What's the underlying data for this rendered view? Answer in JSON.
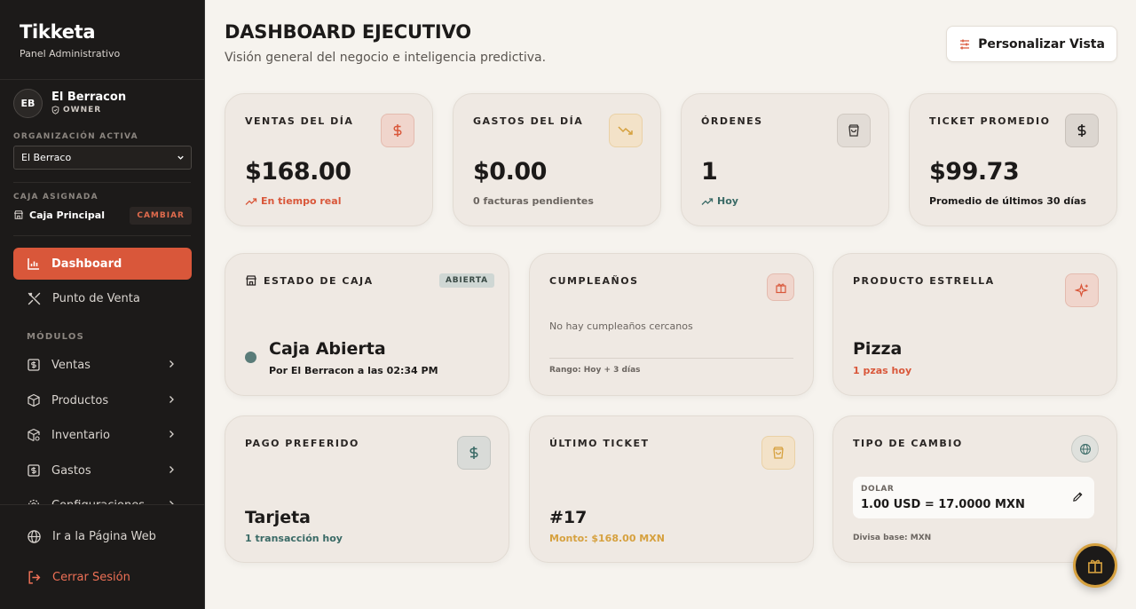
{
  "sidebar": {
    "brand_title": "Tikketa",
    "brand_sub": "Panel Administrativo",
    "user": {
      "initials": "EB",
      "name": "El Berracon",
      "role": "OWNER"
    },
    "org_label": "ORGANIZACIÓN ACTIVA",
    "org_selected": "El Berraco",
    "caja_label": "CAJA ASIGNADA",
    "caja_name": "Caja Principal",
    "caja_change": "CAMBIAR",
    "nav_dashboard": "Dashboard",
    "nav_pos": "Punto de Venta",
    "modules_label": "MÓDULOS",
    "modules": [
      "Ventas",
      "Productos",
      "Inventario",
      "Gastos",
      "Configuraciones"
    ],
    "web_link": "Ir a la Página Web",
    "logout": "Cerrar Sesión"
  },
  "header": {
    "title": "DASHBOARD EJECUTIVO",
    "subtitle": "Visión general del negocio e inteligencia predictiva.",
    "customize_button": "Personalizar Vista"
  },
  "kpis": {
    "ventas": {
      "label": "VENTAS DEL DÍA",
      "value": "$168.00",
      "sub": "En tiempo real"
    },
    "gastos": {
      "label": "GASTOS DEL DÍA",
      "value": "$0.00",
      "sub": "0 facturas pendientes"
    },
    "ordenes": {
      "label": "ÓRDENES",
      "value": "1",
      "sub": "Hoy"
    },
    "ticket": {
      "label": "TICKET PROMEDIO",
      "value": "$99.73",
      "sub": "Promedio de últimos 30 días"
    }
  },
  "estado_caja": {
    "label": "ESTADO DE CAJA",
    "badge": "ABIERTA",
    "title": "Caja Abierta",
    "sub": "Por El Berracon a las 02:34 PM"
  },
  "cumpleanos": {
    "label": "CUMPLEAÑOS",
    "empty": "No hay cumpleaños cercanos",
    "range": "Rango: Hoy + 3 días"
  },
  "producto": {
    "label": "PRODUCTO ESTRELLA",
    "title": "Pizza",
    "sub": "1 pzas hoy"
  },
  "pago": {
    "label": "PAGO PREFERIDO",
    "title": "Tarjeta",
    "sub": "1 transacción hoy"
  },
  "ultimo_ticket": {
    "label": "ÚLTIMO TICKET",
    "title": "#17",
    "sub": "Monto: $168.00 MXN"
  },
  "tipo_cambio": {
    "label": "TIPO DE CAMBIO",
    "currency": "DOLAR",
    "rate": "1.00 USD = 17.0000 MXN",
    "base": "Divisa base: MXN"
  },
  "colors": {
    "accent": "#d9573a",
    "sidebar_bg": "#1c1a19",
    "card_bg": "#efe9e3",
    "teal": "#3a6a66",
    "gold": "#d6a13f"
  }
}
